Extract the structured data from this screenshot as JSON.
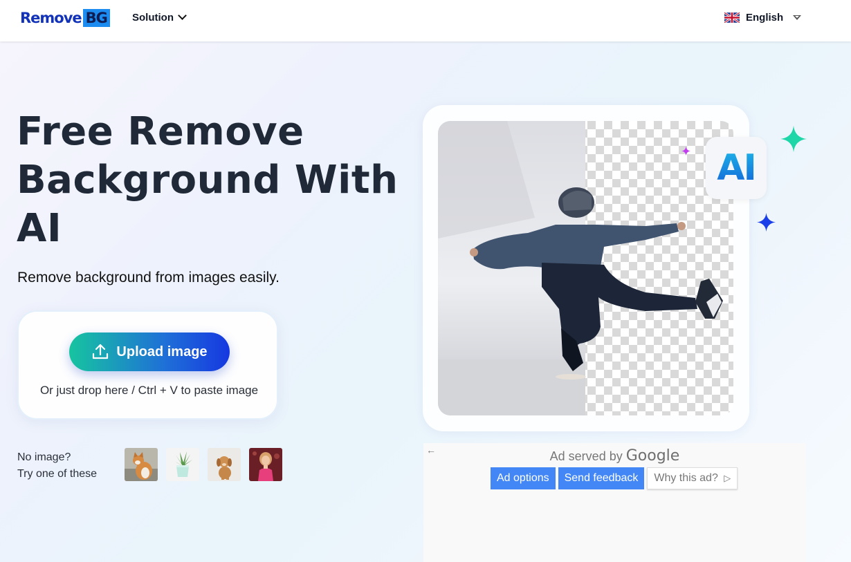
{
  "header": {
    "logo_text_a": "Remove",
    "logo_text_b": "BG",
    "nav_solution": "Solution",
    "language": "English",
    "language_flag_icon": "uk-flag-icon"
  },
  "hero": {
    "title_line1": "Free Remove",
    "title_line2": "Background With",
    "title_line3": "AI",
    "subtitle": "Remove background from images easily."
  },
  "upload": {
    "button_label": "Upload image",
    "button_icon": "upload-icon",
    "drop_hint": "Or just drop here / Ctrl + V to paste image"
  },
  "samples": {
    "line1": "No image?",
    "line2": "Try one of these",
    "items": [
      "cat",
      "plant",
      "puppy",
      "girl"
    ]
  },
  "showcase": {
    "badge": "AI"
  },
  "ad": {
    "served_by": "Ad served by",
    "google": "Google",
    "options": "Ad options",
    "feedback": "Send feedback",
    "why": "Why this ad?",
    "back_icon": "back-arrow-icon"
  },
  "colors": {
    "brand_blue": "#1232b8",
    "upload_gradient_start": "#17c4a0",
    "upload_gradient_end": "#1638e0",
    "ad_button": "#4287f5"
  }
}
